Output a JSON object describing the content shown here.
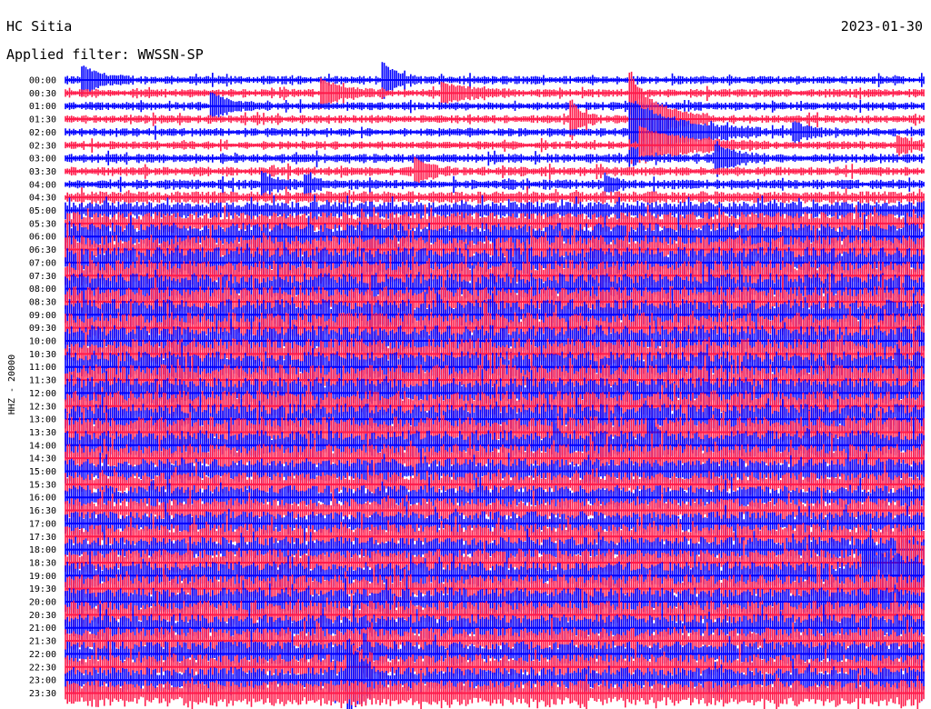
{
  "header": {
    "station": "HC Sitia",
    "date": "2023-01-30",
    "filter": "Applied filter: WWSSN-SP"
  },
  "chart_data": {
    "type": "line",
    "subtype": "helicorder",
    "ylabel": "HHZ - 20000",
    "row_interval_minutes": 30,
    "alternating_colors": [
      "#0000ff",
      "#ff1a4a"
    ],
    "time_labels": [
      "00:00",
      "00:30",
      "01:00",
      "01:30",
      "02:00",
      "02:30",
      "03:00",
      "03:30",
      "04:00",
      "04:30",
      "05:00",
      "05:30",
      "06:00",
      "06:30",
      "07:00",
      "07:30",
      "08:00",
      "08:30",
      "09:00",
      "09:30",
      "10:00",
      "10:30",
      "11:00",
      "11:30",
      "12:00",
      "12:30",
      "13:00",
      "13:30",
      "14:00",
      "14:30",
      "15:00",
      "15:30",
      "16:00",
      "16:30",
      "17:00",
      "17:30",
      "18:00",
      "18:30",
      "19:00",
      "19:30",
      "20:00",
      "20:30",
      "21:00",
      "21:30",
      "22:00",
      "22:30",
      "23:00",
      "23:30"
    ],
    "noise_level": [
      0.15,
      0.15,
      0.15,
      0.15,
      0.15,
      0.15,
      0.17,
      0.18,
      0.2,
      0.3,
      0.5,
      0.7,
      0.85,
      0.9,
      1.0,
      1.0,
      1.0,
      1.0,
      1.0,
      1.0,
      1.0,
      1.0,
      1.0,
      1.0,
      1.0,
      1.0,
      1.0,
      1.0,
      0.95,
      0.9,
      0.8,
      0.75,
      0.75,
      0.75,
      0.75,
      0.78,
      0.8,
      0.85,
      0.9,
      0.9,
      0.9,
      0.9,
      0.85,
      0.85,
      0.8,
      0.8,
      0.8,
      0.8
    ],
    "events": [
      {
        "row": 0,
        "pos": 0.02,
        "amp": 0.9,
        "dur": 0.02
      },
      {
        "row": 0,
        "pos": 0.37,
        "amp": 1.2,
        "dur": 0.015
      },
      {
        "row": 1,
        "pos": 0.3,
        "amp": 0.9,
        "dur": 0.02
      },
      {
        "row": 1,
        "pos": 0.44,
        "amp": 0.6,
        "dur": 0.03
      },
      {
        "row": 2,
        "pos": 0.17,
        "amp": 0.8,
        "dur": 0.02
      },
      {
        "row": 3,
        "pos": 0.59,
        "amp": 1.3,
        "dur": 0.01
      },
      {
        "row": 1,
        "pos": 0.66,
        "amp": 1.4,
        "dur": 0.004
      },
      {
        "row": 3,
        "pos": 0.66,
        "amp": 2.8,
        "dur": 0.03
      },
      {
        "row": 4,
        "pos": 0.66,
        "amp": 2.2,
        "dur": 0.05
      },
      {
        "row": 5,
        "pos": 0.67,
        "amp": 1.2,
        "dur": 0.05
      },
      {
        "row": 6,
        "pos": 0.76,
        "amp": 0.9,
        "dur": 0.02
      },
      {
        "row": 7,
        "pos": 0.41,
        "amp": 0.8,
        "dur": 0.015
      },
      {
        "row": 8,
        "pos": 0.23,
        "amp": 0.7,
        "dur": 0.015
      },
      {
        "row": 8,
        "pos": 0.28,
        "amp": 0.6,
        "dur": 0.01
      },
      {
        "row": 8,
        "pos": 0.63,
        "amp": 0.6,
        "dur": 0.01
      },
      {
        "row": 4,
        "pos": 0.85,
        "amp": 0.6,
        "dur": 0.015
      },
      {
        "row": 5,
        "pos": 0.97,
        "amp": 0.6,
        "dur": 0.015
      },
      {
        "row": 28,
        "pos": 0.57,
        "amp": 1.5,
        "dur": 0.005
      },
      {
        "row": 28,
        "pos": 0.68,
        "amp": 2.0,
        "dur": 0.008
      },
      {
        "row": 37,
        "pos": 0.97,
        "amp": 1.8,
        "dur": 0.03
      },
      {
        "row": 38,
        "pos": 0.93,
        "amp": 1.8,
        "dur": 0.04
      },
      {
        "row": 45,
        "pos": 0.33,
        "amp": 1.8,
        "dur": 0.01
      },
      {
        "row": 46,
        "pos": 0.33,
        "amp": 2.4,
        "dur": 0.015
      }
    ]
  }
}
